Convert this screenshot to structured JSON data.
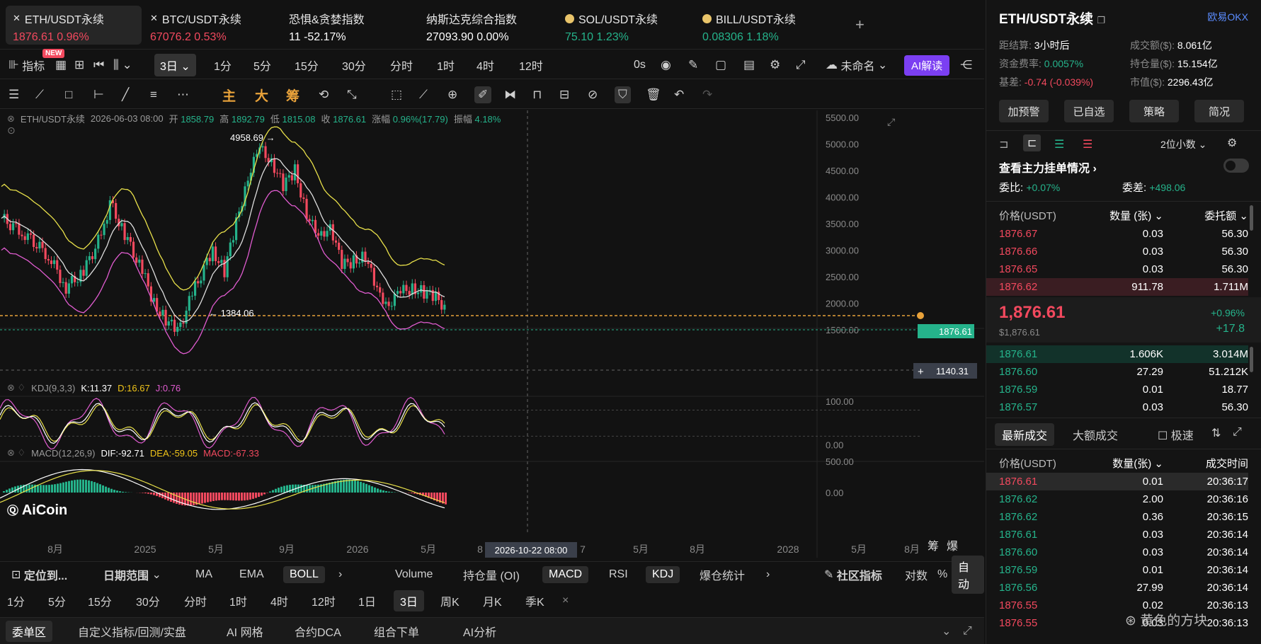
{
  "tickers": [
    {
      "name": "ETH/USDT永续",
      "price": "1876.61",
      "change": "0.96%",
      "dir": "red",
      "icon": "okx-x-icon"
    },
    {
      "name": "BTC/USDT永续",
      "price": "67076.2",
      "change": "0.53%",
      "dir": "red",
      "icon": "okx-x-icon"
    },
    {
      "name": "恐惧&贪婪指数",
      "price": "11",
      "change": "-52.17%",
      "dir": "white",
      "icon": ""
    },
    {
      "name": "纳斯达克综合指数",
      "price": "27093.90",
      "change": "0.00%",
      "dir": "white",
      "icon": ""
    },
    {
      "name": "SOL/USDT永续",
      "price": "75.10",
      "change": "1.23%",
      "dir": "green",
      "icon": "coin-icon"
    },
    {
      "name": "BILL/USDT永续",
      "price": "0.08306",
      "change": "1.18%",
      "dir": "green",
      "icon": "coin-icon"
    }
  ],
  "add_tab": "+",
  "toolbar1": {
    "indicator_label": "指标",
    "new_badge": "NEW",
    "timeframe_selected": "3日",
    "timeframes": [
      "1分",
      "5分",
      "15分",
      "30分",
      "分时",
      "1时",
      "4时",
      "12时"
    ],
    "countdown": "0s",
    "layout_name": "未命名",
    "ai_button": "AI解读"
  },
  "toolbar2": {
    "chips": [
      "主",
      "大",
      "筹"
    ]
  },
  "chart": {
    "ohlc_label": "ETH/USDT永续",
    "date": "2026-06-03 08:00",
    "open_label": "开",
    "open": "1858.79",
    "high_label": "高",
    "high": "1892.79",
    "low_label": "低",
    "low": "1815.08",
    "close_label": "收",
    "close": "1876.61",
    "change_label": "涨幅",
    "change": "0.96%(17.79)",
    "amp_label": "振幅",
    "amp": "4.18%",
    "high_mark": "4958.69",
    "low_mark": "1384.06",
    "last_price_tag": "1876.61",
    "crosshair_price": "1140.31",
    "crosshair_date": "2026-10-22 08:00",
    "y_ticks": [
      "5500.00",
      "5000.00",
      "4500.00",
      "4000.00",
      "3500.00",
      "3000.00",
      "2500.00",
      "2000.00",
      "1500.00"
    ],
    "kdj_label": "KDJ(9,3,3)",
    "kdj_k": "K:11.37",
    "kdj_d": "D:16.67",
    "kdj_j": "J:0.76",
    "kdj_ticks": [
      "100.00",
      "0.00"
    ],
    "macd_label": "MACD(12,26,9)",
    "macd_dif": "DIF:-92.71",
    "macd_dea": "DEA:-59.05",
    "macd_macd": "MACD:-67.33",
    "macd_ticks": [
      "500.00",
      "0.00"
    ],
    "x_ticks": [
      "8月",
      "2025",
      "5月",
      "9月",
      "2026",
      "5月",
      "8",
      "7",
      "5月",
      "8月",
      "2028",
      "5月",
      "8月"
    ],
    "watermark": "AiCoin",
    "corner_labels": [
      "筹",
      "爆"
    ]
  },
  "indicator_bar": {
    "locate": "定位到...",
    "date_range": "日期范围",
    "main_inds": [
      "MA",
      "EMA",
      "BOLL"
    ],
    "active_main": "BOLL",
    "sub_inds": [
      "Volume",
      "持仓量 (OI)",
      "MACD",
      "RSI",
      "KDJ",
      "爆仓统计"
    ],
    "active_sub": [
      "MACD",
      "KDJ"
    ],
    "community": "社区指标",
    "log_label": "对数",
    "pct_label": "%",
    "auto_label": "自动"
  },
  "tf_bar": [
    "1分",
    "5分",
    "15分",
    "30分",
    "分时",
    "1时",
    "4时",
    "12时",
    "1日",
    "3日",
    "周K",
    "月K",
    "季K"
  ],
  "tf_bar_active": "3日",
  "bottom_tabs": [
    "委单区",
    "自定义指标/回测/实盘",
    "AI 网格",
    "合约DCA",
    "组合下单",
    "AI分析"
  ],
  "right": {
    "symbol": "ETH/USDT永续",
    "exchange": "欧易OKX",
    "settle_label": "距结算:",
    "settle_value": "3小时后",
    "turnover_label": "成交额($):",
    "turnover_value": "8.061亿",
    "fund_label": "资金费率:",
    "fund_value": "0.0057%",
    "oi_label": "持仓量($):",
    "oi_value": "15.154亿",
    "basis_label": "基差:",
    "basis_value": "-0.74 (-0.039%)",
    "mcap_label": "市值($):",
    "mcap_value": "2296.43亿",
    "buttons": [
      "加预警",
      "已自选",
      "策略",
      "简况"
    ],
    "decimals": "2位小数",
    "mainforce": "查看主力挂单情况",
    "wb_label": "委比:",
    "wb_value": "+0.07%",
    "wc_label": "委差:",
    "wc_value": "+498.06",
    "ob_headers": [
      "价格(USDT)",
      "数量 (张)",
      "委托额"
    ],
    "asks": [
      [
        "1876.67",
        "0.03",
        "56.30"
      ],
      [
        "1876.66",
        "0.03",
        "56.30"
      ],
      [
        "1876.65",
        "0.03",
        "56.30"
      ],
      [
        "1876.62",
        "911.78",
        "1.711M"
      ]
    ],
    "last_price": "1,876.61",
    "last_usd": "$1,876.61",
    "last_pct": "+0.96%",
    "last_chg": "+17.8",
    "bids": [
      [
        "1876.61",
        "1.606K",
        "3.014M"
      ],
      [
        "1876.60",
        "27.29",
        "51.212K"
      ],
      [
        "1876.59",
        "0.01",
        "18.77"
      ],
      [
        "1876.57",
        "0.03",
        "56.30"
      ]
    ],
    "trade_tabs": [
      "最新成交",
      "大额成交"
    ],
    "fast_label": "极速",
    "trade_headers": [
      "价格(USDT)",
      "数量(张)",
      "成交时间"
    ],
    "trades": [
      [
        "1876.61",
        "0.01",
        "20:36:17",
        "red"
      ],
      [
        "1876.62",
        "2.00",
        "20:36:16",
        "green"
      ],
      [
        "1876.62",
        "0.36",
        "20:36:15",
        "green"
      ],
      [
        "1876.61",
        "0.03",
        "20:36:14",
        "green"
      ],
      [
        "1876.60",
        "0.03",
        "20:36:14",
        "green"
      ],
      [
        "1876.59",
        "0.01",
        "20:36:14",
        "green"
      ],
      [
        "1876.56",
        "27.99",
        "20:36:14",
        "green"
      ],
      [
        "1876.55",
        "0.02",
        "20:36:13",
        "red"
      ],
      [
        "1876.55",
        "0.03",
        "20:36:13",
        "red"
      ]
    ],
    "watermark": "黄色的方块"
  }
}
